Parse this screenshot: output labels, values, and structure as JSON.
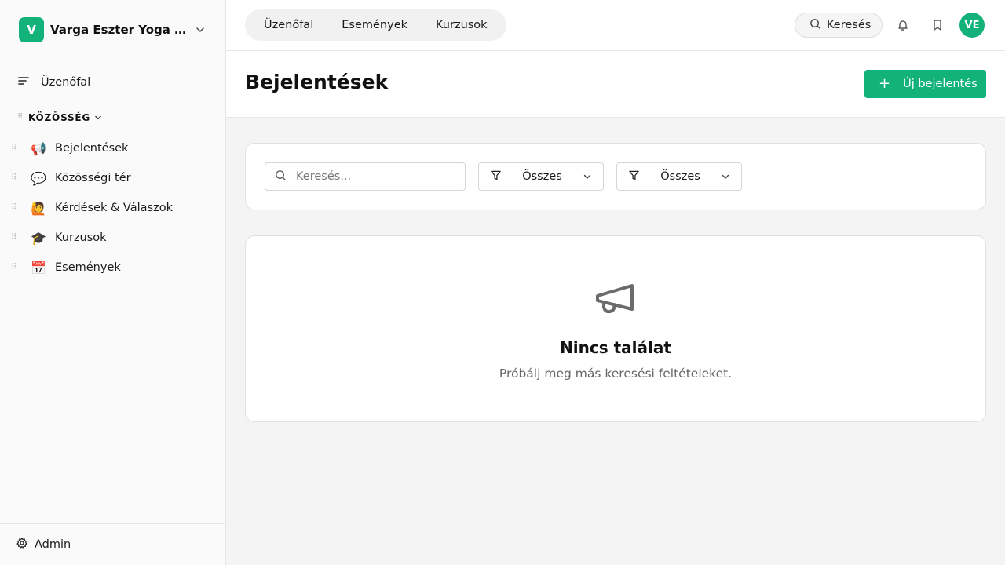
{
  "sidebar": {
    "brand": {
      "logo_letter": "V",
      "name": "Varga Eszter Yoga & Meditáció"
    },
    "feed_label": "Üzenőfal",
    "section": {
      "title": "KÖZÖSSÉG"
    },
    "spaces": [
      {
        "emoji": "📢",
        "label": "Bejelentések"
      },
      {
        "emoji": "💬",
        "label": "Közösségi tér"
      },
      {
        "emoji": "🙋",
        "label": "Kérdések & Válaszok"
      },
      {
        "emoji": "🎓",
        "label": "Kurzusok"
      },
      {
        "emoji": "📅",
        "label": "Események"
      }
    ],
    "footer": {
      "label": "Admin"
    }
  },
  "topbar": {
    "tabs": [
      "Üzenőfal",
      "Események",
      "Kurzusok"
    ],
    "search_label": "Keresés",
    "avatar_initials": "VE"
  },
  "page": {
    "title": "Bejelentések",
    "new_button": {
      "plus": "+",
      "label": "Új bejelentés"
    }
  },
  "filters": {
    "search_placeholder": "Keresés...",
    "select1": "Összes",
    "select2": "Összes"
  },
  "empty": {
    "title": "Nincs találat",
    "subtitle": "Próbálj meg más keresési feltételeket."
  },
  "colors": {
    "accent": "#13b27b",
    "background": "#f4f4f4"
  },
  "icons": [
    "chevron-down-icon",
    "menu-icon",
    "drag-handle-icon",
    "search-icon",
    "bell-icon",
    "bookmark-icon",
    "filter-icon",
    "megaphone-icon",
    "gear-icon"
  ]
}
